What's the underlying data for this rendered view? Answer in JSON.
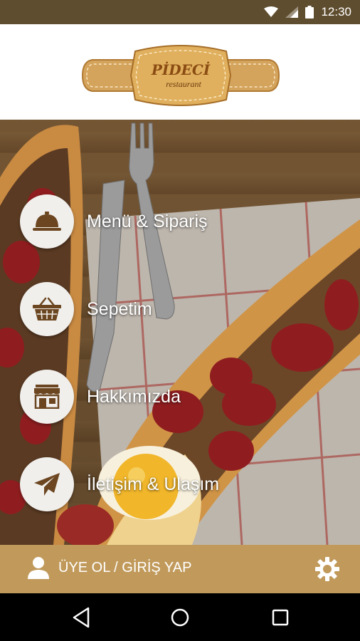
{
  "status_bar": {
    "time": "12:30",
    "icons": [
      "wifi-icon",
      "cell-signal-icon",
      "battery-icon"
    ]
  },
  "header": {
    "logo_text": "PİDECİ",
    "logo_sub": "restaurant"
  },
  "menu": [
    {
      "label": "Menü & Sipariş",
      "icon": "food-cloche-icon"
    },
    {
      "label": "Sepetim",
      "icon": "basket-icon"
    },
    {
      "label": "Hakkımızda",
      "icon": "storefront-icon"
    },
    {
      "label": "İletişim & Ulaşım",
      "icon": "paper-plane-icon"
    }
  ],
  "bottom_bar": {
    "login_label": "ÜYE OL / GİRİŞ YAP",
    "icons": [
      "user-icon",
      "gear-icon"
    ]
  },
  "nav_bar": {
    "icons": [
      "back-icon",
      "home-icon",
      "recents-icon"
    ]
  },
  "colors": {
    "status_bar": "#5f4d2f",
    "accent": "#c19a5b",
    "icon": "#6b4620"
  }
}
